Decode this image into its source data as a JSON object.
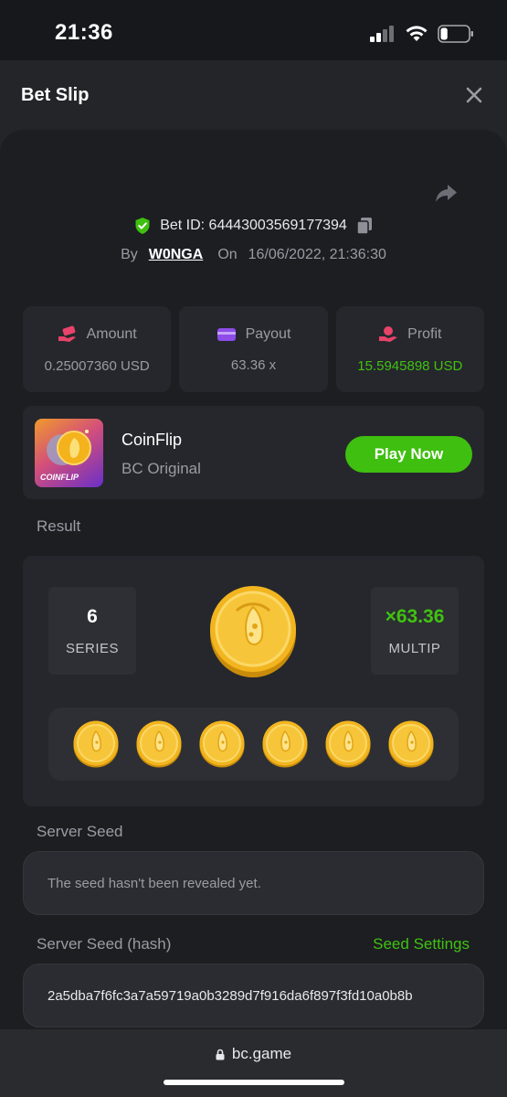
{
  "status_bar": {
    "time": "21:36",
    "battery_level": 0.25
  },
  "header": {
    "title": "Bet Slip"
  },
  "bet": {
    "id_label": "Bet ID: 64443003569177394",
    "by_label": "By",
    "username": "W0NGA",
    "on_label": "On",
    "datetime": "16/06/2022, 21:36:30"
  },
  "stats": [
    {
      "label": "Amount",
      "value": "0.25007360 USD",
      "icon": "money-hand-icon"
    },
    {
      "label": "Payout",
      "value": "63.36 x",
      "icon": "wallet-icon"
    },
    {
      "label": "Profit",
      "value": "15.5945898 USD",
      "icon": "profit-icon"
    }
  ],
  "game": {
    "name": "CoinFlip",
    "provider": "BC Original",
    "thumb_label": "COINFLIP",
    "play_label": "Play Now"
  },
  "result": {
    "section_label": "Result",
    "series_value": "6",
    "series_label": "SERIES",
    "multiplier_value": "×63.36",
    "multiplier_label": "MULTIP",
    "coin_count": 6
  },
  "server_seed": {
    "label": "Server Seed",
    "value": "The seed hasn't been revealed yet."
  },
  "server_seed_hash": {
    "label": "Server Seed (hash)",
    "settings_label": "Seed Settings",
    "value": "2a5dba7f6fc3a7a59719a0b3289d7f916da6f897f3fd10a0b8b"
  },
  "browser": {
    "url": "bc.game"
  },
  "colors": {
    "accent_green": "#3fbf10",
    "profit_green": "#40c210",
    "coin_gold": "#f2b51f"
  }
}
